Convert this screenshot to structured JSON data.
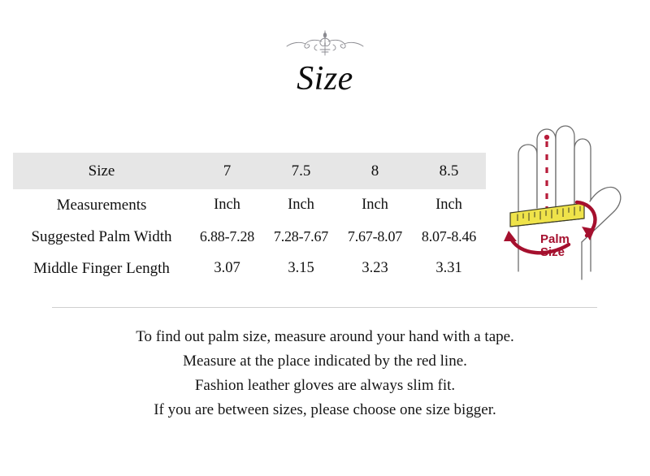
{
  "document": {
    "title": "Size",
    "ornament_icon": "flourish-ornament-icon"
  },
  "table": {
    "header": {
      "label": "Size",
      "sizes": [
        "7",
        "7.5",
        "8",
        "8.5"
      ]
    },
    "rows": [
      {
        "label": "Measurements",
        "values": [
          "Inch",
          "Inch",
          "Inch",
          "Inch"
        ]
      },
      {
        "label": "Suggested Palm Width",
        "values": [
          "6.88-7.28",
          "7.28-7.67",
          "7.67-8.07",
          "8.07-8.46"
        ]
      },
      {
        "label": "Middle Finger Length",
        "values": [
          "3.07",
          "3.15",
          "3.23",
          "3.31"
        ]
      }
    ]
  },
  "illustration": {
    "name": "hand-palm-measurement-diagram",
    "palm_label_line1": "Palm",
    "palm_label_line2": "Size",
    "tape_icon": "measuring-tape-icon",
    "arrow_icon": "curved-arrow-icon",
    "dashed_line_icon": "middle-finger-dashed-line-icon",
    "colors": {
      "tape_fill": "#efe34a",
      "tape_stroke": "#3c3c28",
      "accent_red": "#a5102e",
      "dashed_red": "#b81c3a",
      "hand_outline": "#6e6e6e"
    }
  },
  "notes": [
    "To find out palm size, measure around your hand with a tape.",
    "Measure at the place indicated by the red line.",
    "Fashion leather gloves are always slim fit.",
    "If you are between sizes, please choose one size bigger."
  ]
}
